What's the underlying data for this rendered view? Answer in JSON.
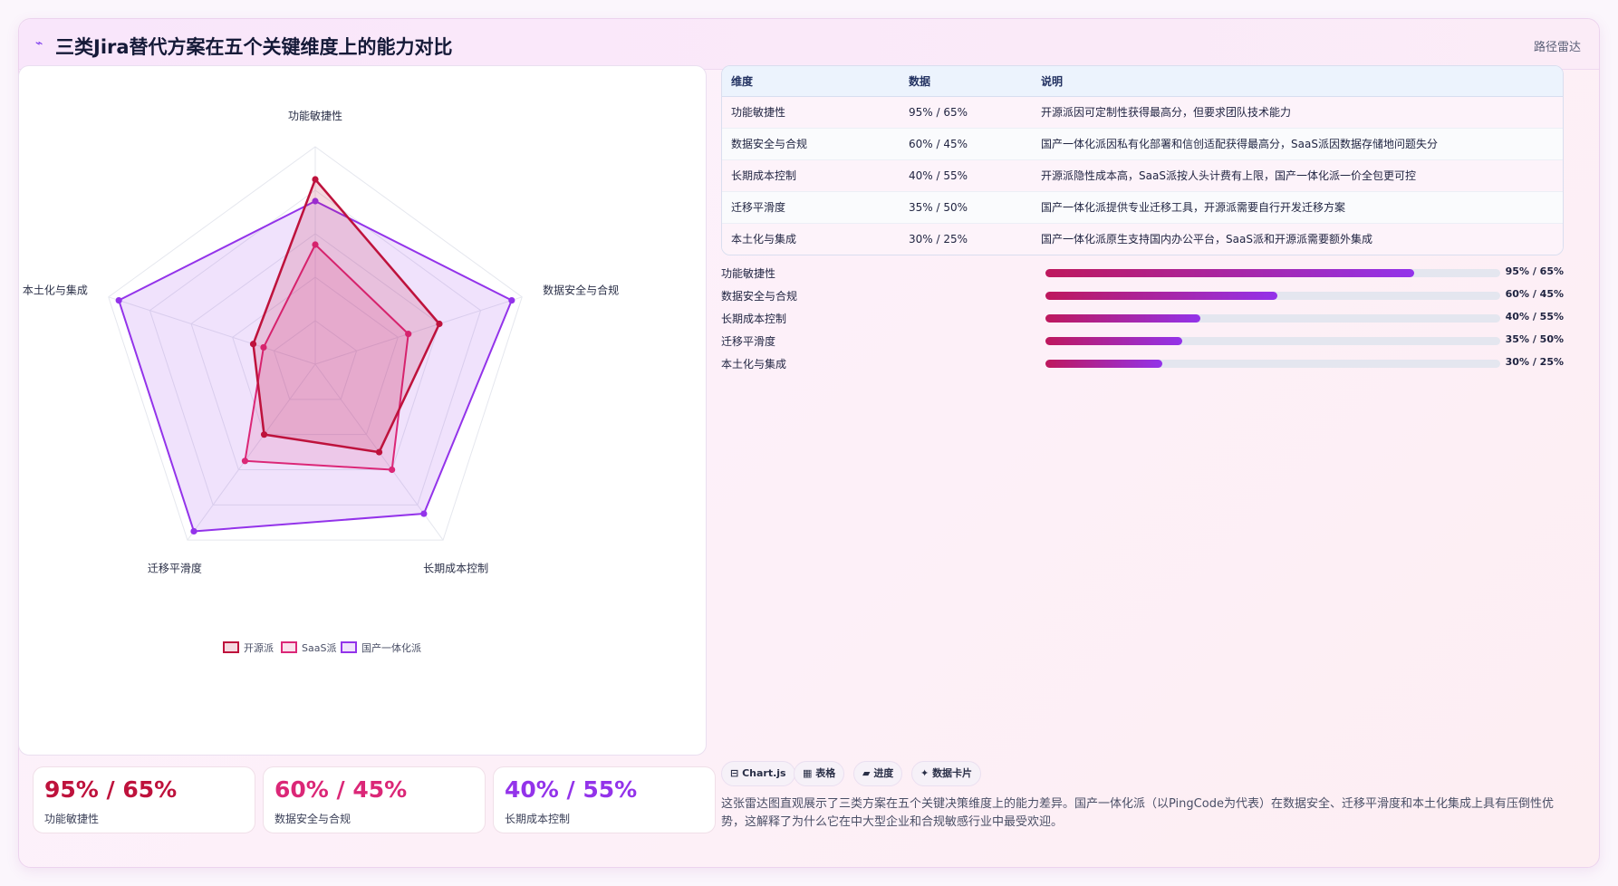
{
  "header": {
    "icon": "pulse-icon",
    "title": "三类Jira替代方案在五个关键维度上的能力对比",
    "right_label": "路径雷达"
  },
  "colors": {
    "open_source": "#be123c",
    "saas": "#db2777",
    "domestic": "#9333ea"
  },
  "chart_data": {
    "type": "radar",
    "axes": [
      "功能敏捷性",
      "数据安全与合规",
      "长期成本控制",
      "迁移平滑度",
      "本土化与集成"
    ],
    "range": [
      0,
      100
    ],
    "grid_levels": 5,
    "legend_position": "bottom",
    "series": [
      {
        "name": "开源派",
        "values": [
          85,
          60,
          50,
          40,
          30
        ]
      },
      {
        "name": "SaaS派",
        "values": [
          55,
          45,
          60,
          55,
          25
        ]
      },
      {
        "name": "国产一体化派",
        "values": [
          75,
          95,
          85,
          95,
          95
        ]
      }
    ]
  },
  "table": {
    "headers": [
      "维度",
      "数据",
      "说明"
    ],
    "rows": [
      [
        "功能敏捷性",
        "95% / 65%",
        "开源派因可定制性获得最高分，但要求团队技术能力"
      ],
      [
        "数据安全与合规",
        "60% / 45%",
        "国产一体化派因私有化部署和信创适配获得最高分，SaaS派因数据存储地问题失分"
      ],
      [
        "长期成本控制",
        "40% / 55%",
        "开源派隐性成本高，SaaS派按人头计费有上限，国产一体化派一价全包更可控"
      ],
      [
        "迁移平滑度",
        "35% / 50%",
        "国产一体化派提供专业迁移工具，开源派需要自行开发迁移方案"
      ],
      [
        "本土化与集成",
        "30% / 25%",
        "国产一体化派原生支持国内办公平台，SaaS派和开源派需要额外集成"
      ]
    ]
  },
  "bars": [
    {
      "label": "功能敏捷性",
      "value": "95% / 65%",
      "fill": 0.81
    },
    {
      "label": "数据安全与合规",
      "value": "60% / 45%",
      "fill": 0.51
    },
    {
      "label": "长期成本控制",
      "value": "40% / 55%",
      "fill": 0.34
    },
    {
      "label": "迁移平滑度",
      "value": "35% / 50%",
      "fill": 0.3
    },
    {
      "label": "本土化与集成",
      "value": "30% / 25%",
      "fill": 0.256
    }
  ],
  "stats": [
    {
      "value": "95% / 65%",
      "label": "功能敏捷性",
      "color": "#be123c"
    },
    {
      "value": "60% / 45%",
      "label": "数据安全与合规",
      "color": "#db2777"
    },
    {
      "value": "40% / 55%",
      "label": "长期成本控制",
      "color": "#9333ea"
    }
  ],
  "chips": [
    {
      "icon": "table-icon",
      "glyph": "⊟",
      "label": "Chart.js"
    },
    {
      "icon": "grid-icon",
      "glyph": "▦",
      "label": "表格"
    },
    {
      "icon": "progress-icon",
      "glyph": "▰",
      "label": "进度"
    },
    {
      "icon": "sparkle-icon",
      "glyph": "✦",
      "label": "数据卡片"
    }
  ],
  "description": "这张雷达图直观展示了三类方案在五个关键决策维度上的能力差异。国产一体化派（以PingCode为代表）在数据安全、迁移平滑度和本土化集成上具有压倒性优势，这解释了为什么它在中大型企业和合规敏感行业中最受欢迎。"
}
